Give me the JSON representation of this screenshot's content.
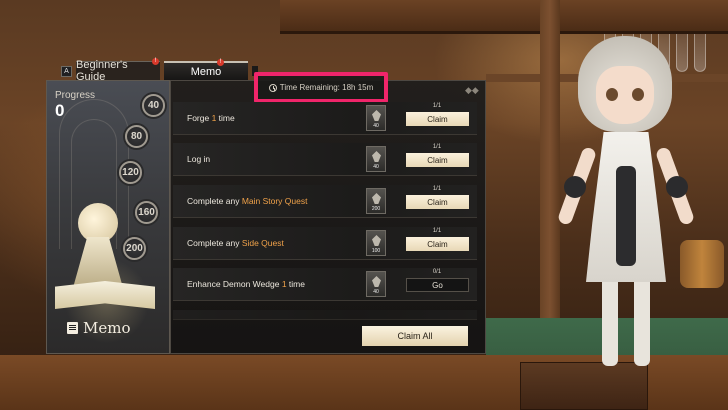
{
  "tabs": {
    "key_hint": "A",
    "beginners_guide": "Beginner's Guide",
    "memo": "Memo",
    "badge_guide": "!",
    "badge_memo": "!"
  },
  "timer": {
    "text": "Time Remaining: 18h 15m"
  },
  "progress": {
    "label": "Progress",
    "value": "0",
    "milestones": [
      "40",
      "80",
      "120",
      "160",
      "200"
    ]
  },
  "brand": {
    "title": "Memo"
  },
  "quests": [
    {
      "pre": "Forge ",
      "hl": "1",
      "post": " time",
      "reward": "40",
      "count": "1/1",
      "action": "Claim"
    },
    {
      "pre": "Log in",
      "hl": "",
      "post": "",
      "reward": "40",
      "count": "1/1",
      "action": "Claim"
    },
    {
      "pre": "Complete any ",
      "hl": "Main Story Quest",
      "post": "",
      "reward": "200",
      "count": "1/1",
      "action": "Claim"
    },
    {
      "pre": "Complete any ",
      "hl": "Side Quest",
      "post": "",
      "reward": "100",
      "count": "1/1",
      "action": "Claim"
    },
    {
      "pre": "Enhance Demon Wedge ",
      "hl": "1",
      "post": " time",
      "reward": "40",
      "count": "0/1",
      "action": "Go"
    }
  ],
  "footer": {
    "claim_all": "Claim All"
  },
  "colors": {
    "highlight": "#f0a24a",
    "timer_outline": "#f0256a",
    "claim_button": "#f4e6c8",
    "badge": "#d8392b"
  }
}
